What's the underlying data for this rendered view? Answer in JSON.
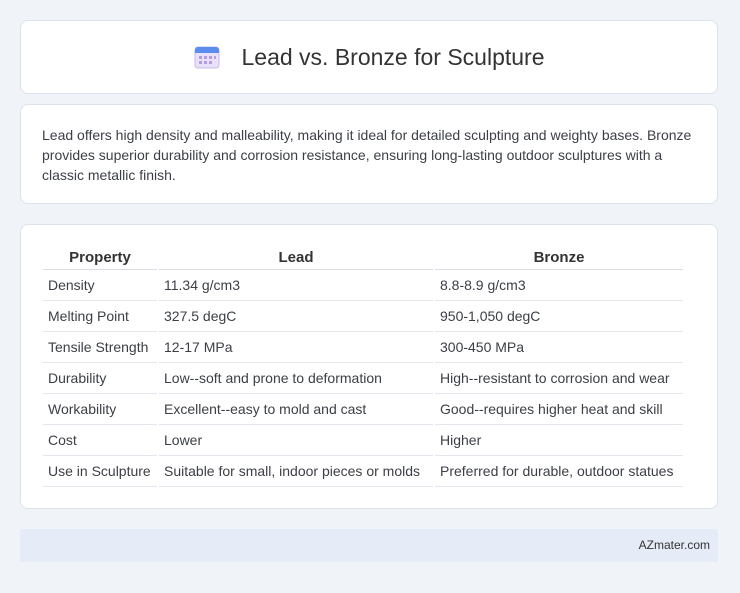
{
  "header": {
    "title": "Lead vs. Bronze for Sculpture",
    "icon": "calendar-icon"
  },
  "description": "Lead offers high density and malleability, making it ideal for detailed sculpting and weighty bases. Bronze provides superior durability and corrosion resistance, ensuring long-lasting outdoor sculptures with a classic metallic finish.",
  "table": {
    "headers": [
      "Property",
      "Lead",
      "Bronze"
    ],
    "rows": [
      [
        "Density",
        "11.34 g/cm3",
        "8.8-8.9 g/cm3"
      ],
      [
        "Melting Point",
        "327.5 degC",
        "950-1,050 degC"
      ],
      [
        "Tensile Strength",
        "12-17 MPa",
        "300-450 MPa"
      ],
      [
        "Durability",
        "Low--soft and prone to deformation",
        "High--resistant to corrosion and wear"
      ],
      [
        "Workability",
        "Excellent--easy to mold and cast",
        "Good--requires higher heat and skill"
      ],
      [
        "Cost",
        "Lower",
        "Higher"
      ],
      [
        "Use in Sculpture",
        "Suitable for small, indoor pieces or molds",
        "Preferred for durable, outdoor statues"
      ]
    ]
  },
  "footer": {
    "text": "AZmater.com"
  },
  "colors": {
    "background": "#f0f3f8",
    "card": "#ffffff",
    "footer": "#e6ecf7",
    "icon_top": "#5b8def",
    "icon_body": "#e6dcf7"
  }
}
